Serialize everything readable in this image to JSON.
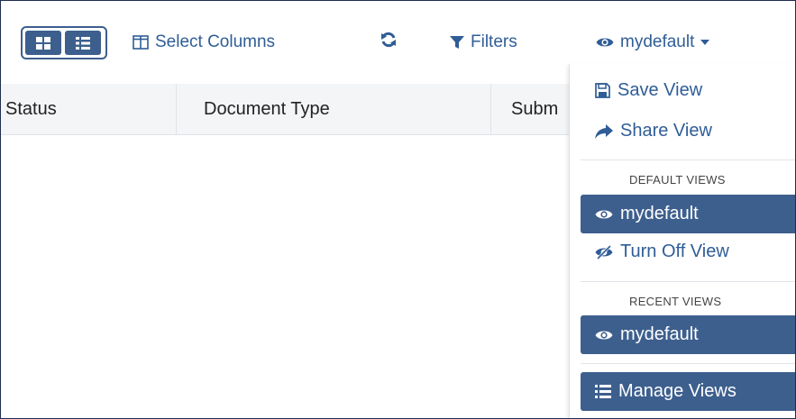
{
  "toolbar": {
    "select_columns_label": "Select Columns",
    "filters_label": "Filters",
    "view_label": "mydefault"
  },
  "table": {
    "columns": [
      "Status",
      "Document Type",
      "Subm"
    ]
  },
  "dropdown": {
    "save_view": "Save View",
    "share_view": "Share View",
    "default_views_heading": "DEFAULT VIEWS",
    "default_view": "mydefault",
    "turn_off_view": "Turn Off View",
    "recent_views_heading": "RECENT VIEWS",
    "recent_view": "mydefault",
    "manage_views": "Manage Views"
  },
  "colors": {
    "accent": "#3d5f8e",
    "link": "#2f5d96"
  },
  "icons": {
    "view_toggle": [
      "grid-icon",
      "list-icon"
    ],
    "select_columns": "columns-icon",
    "refresh": "refresh-icon",
    "filters": "filter-icon",
    "view": "eye-icon",
    "save_view": "floppy-disk-icon",
    "share_view": "share-arrow-icon",
    "turn_off_view": "eye-slash-icon",
    "manage_views": "list-icon"
  }
}
